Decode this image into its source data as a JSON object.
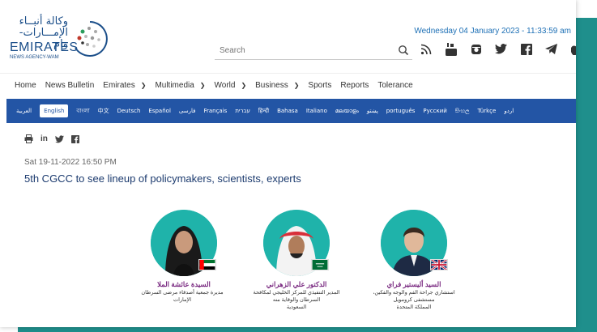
{
  "logo": {
    "arabic_line1": "وكالة أنبــاء",
    "arabic_line2": "الإمـــارات-وام",
    "english": "EMIRATES",
    "subtitle": "NEWS AGENCY-WAM"
  },
  "header": {
    "datetime": "Wednesday 04 January 2023 - 11:33:59 am",
    "search_placeholder": "Search",
    "social_icons": [
      "rss-icon",
      "youtube-icon",
      "instagram-icon",
      "twitter-icon",
      "facebook-icon",
      "telegram-icon",
      "apple-icon"
    ]
  },
  "nav": {
    "items": [
      {
        "label": "Home",
        "dropdown": false
      },
      {
        "label": "News Bulletin",
        "dropdown": false
      },
      {
        "label": "Emirates",
        "dropdown": true
      },
      {
        "label": "Multimedia",
        "dropdown": true
      },
      {
        "label": "World",
        "dropdown": true
      },
      {
        "label": "Business",
        "dropdown": true
      },
      {
        "label": "Sports",
        "dropdown": false
      },
      {
        "label": "Reports",
        "dropdown": false
      },
      {
        "label": "Tolerance",
        "dropdown": false
      }
    ]
  },
  "languages": {
    "active": "English",
    "items": [
      "العربية",
      "English",
      "বাংলা",
      "中文",
      "Deutsch",
      "Español",
      "فارسی",
      "Français",
      "עברית",
      "हिन्दी",
      "Bahasa",
      "Italiano",
      "മലയാളം",
      "پښتو",
      "português",
      "Русский",
      "සිංහල",
      "Türkçe",
      "اردو"
    ]
  },
  "article": {
    "share_icons": [
      "print-icon",
      "linkedin-icon",
      "twitter-icon",
      "facebook-icon"
    ],
    "date": "Sat 19-11-2022 16:50 PM",
    "title": "5th CGCC to see lineup of policymakers, scientists, experts"
  },
  "speakers": [
    {
      "name": "السيدة عائشة الملا",
      "title_line1": "مديرة جمعية أصدقاء مرضى السرطان",
      "title_line2": "الإمارات",
      "title_line3": "",
      "flag": "uae"
    },
    {
      "name": "الدكتور علي الزهراني",
      "title_line1": "المدير التنفيذي للمركز الخليجي لمكافحة",
      "title_line2": "السرطان والوقاية منه",
      "title_line3": "السعودية",
      "flag": "saudi"
    },
    {
      "name": "السيد أليستير فراي",
      "title_line1": "استشاري جراحة الفم والوجه والفكين،",
      "title_line2": "مستشفى كرومويل",
      "title_line3": "المملكة المتحدة",
      "flag": "uk"
    }
  ],
  "colors": {
    "brand_blue": "#2355a5",
    "teal": "#1f8f8c",
    "speaker_name": "#7b2c82",
    "headline": "#1b3a6e"
  }
}
